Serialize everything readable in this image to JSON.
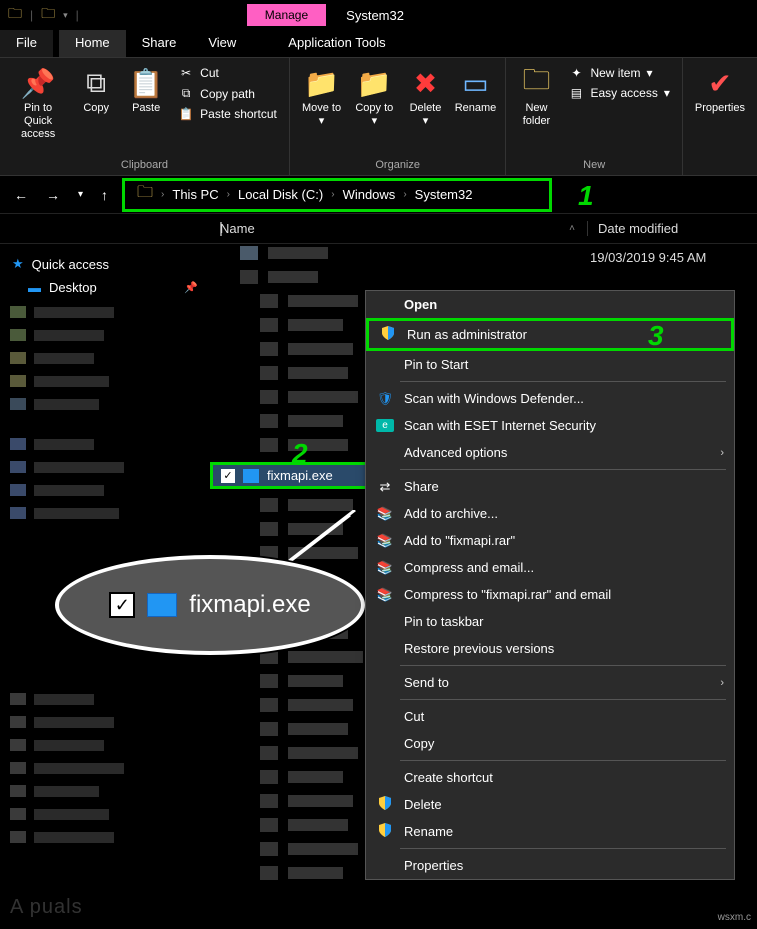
{
  "window": {
    "manage_tab": "Manage",
    "title": "System32"
  },
  "tabs": {
    "file": "File",
    "home": "Home",
    "share": "Share",
    "view": "View",
    "app_tools": "Application Tools"
  },
  "ribbon": {
    "pin": "Pin to Quick access",
    "copy": "Copy",
    "paste": "Paste",
    "cut": "Cut",
    "copy_path": "Copy path",
    "paste_shortcut": "Paste shortcut",
    "group_clipboard": "Clipboard",
    "move_to": "Move to",
    "copy_to": "Copy to",
    "delete": "Delete",
    "rename": "Rename",
    "group_organize": "Organize",
    "new_folder": "New folder",
    "new_item": "New item",
    "easy_access": "Easy access",
    "group_new": "New",
    "properties": "Properties"
  },
  "breadcrumb": {
    "items": [
      "This PC",
      "Local Disk (C:)",
      "Windows",
      "System32"
    ]
  },
  "columns": {
    "name": "Name",
    "date": "Date modified"
  },
  "date_value": "19/03/2019 9:45 AM",
  "sidebar": {
    "quick_access": "Quick access",
    "desktop": "Desktop"
  },
  "selected_file": "fixmapi.exe",
  "magnified_file": "fixmapi.exe",
  "context_menu": {
    "open": "Open",
    "run_admin": "Run as administrator",
    "pin_start": "Pin to Start",
    "defender": "Scan with Windows Defender...",
    "eset": "Scan with ESET Internet Security",
    "advanced": "Advanced options",
    "share": "Share",
    "add_archive": "Add to archive...",
    "add_rar": "Add to \"fixmapi.rar\"",
    "compress_email": "Compress and email...",
    "compress_rar_email": "Compress to \"fixmapi.rar\" and email",
    "pin_taskbar": "Pin to taskbar",
    "restore": "Restore previous versions",
    "send_to": "Send to",
    "cut": "Cut",
    "copy": "Copy",
    "create_shortcut": "Create shortcut",
    "delete": "Delete",
    "rename": "Rename",
    "properties": "Properties"
  },
  "callouts": {
    "c1": "1",
    "c2": "2",
    "c3": "3"
  },
  "watermark": "A  puals",
  "wsxm": "wsxm.c"
}
